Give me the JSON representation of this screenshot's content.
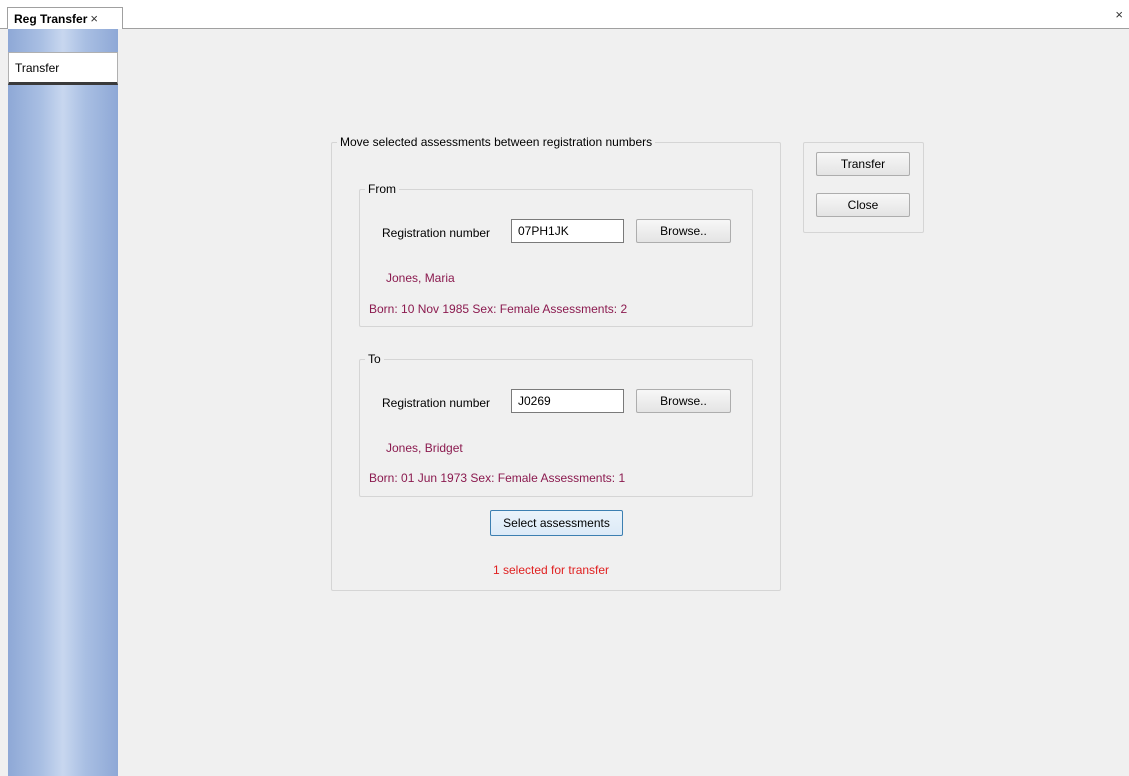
{
  "tabs": {
    "doc_tab_label": "Reg Transfer",
    "doc_tab_close": "×",
    "window_close": "×"
  },
  "sidebar": {
    "tab_label": "Transfer"
  },
  "main": {
    "group_title": "Move selected assessments between registration numbers",
    "from": {
      "title": "From",
      "regno_label": "Registration number",
      "regno_value": "07PH1JK",
      "browse_label": "Browse..",
      "name": "Jones, Maria",
      "info": "Born: 10 Nov 1985  Sex: Female  Assessments: 2"
    },
    "to": {
      "title": "To",
      "regno_label": "Registration number",
      "regno_value": "J0269",
      "browse_label": "Browse..",
      "name": "Jones, Bridget",
      "info": "Born: 01 Jun 1973  Sex: Female  Assessments: 1"
    },
    "select_button": "Select assessments",
    "selected_message": "1 selected for transfer"
  },
  "actions": {
    "transfer_label": "Transfer",
    "close_label": "Close"
  },
  "colors": {
    "person_text": "#8b1a4f",
    "selected_text": "#e02020",
    "sidebar_gradient": "#a9bfe3"
  }
}
